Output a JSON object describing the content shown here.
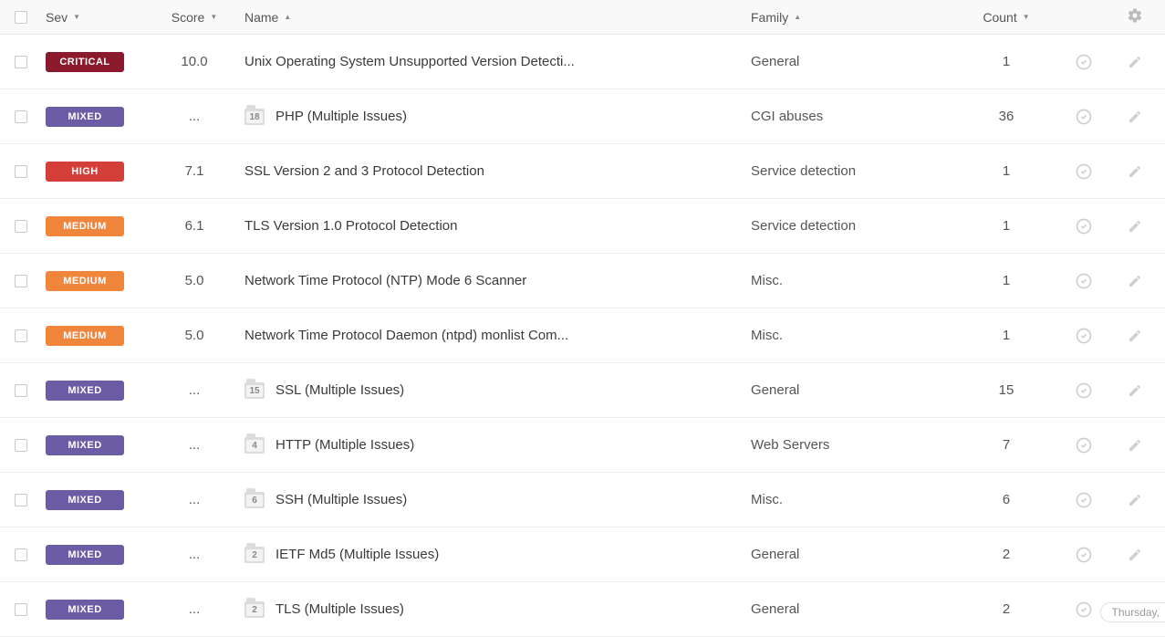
{
  "columns": {
    "sev": {
      "label": "Sev",
      "sort": "desc"
    },
    "score": {
      "label": "Score",
      "sort": "desc"
    },
    "name": {
      "label": "Name",
      "sort": "asc"
    },
    "family": {
      "label": "Family",
      "sort": "asc"
    },
    "count": {
      "label": "Count",
      "sort": "desc"
    }
  },
  "rows": [
    {
      "sev": "CRITICAL",
      "sev_class": "critical",
      "score": "10.0",
      "group_count": null,
      "name": "Unix Operating System Unsupported Version Detecti...",
      "family": "General",
      "count": "1"
    },
    {
      "sev": "MIXED",
      "sev_class": "mixed",
      "score": "...",
      "group_count": "18",
      "name": "PHP (Multiple Issues)",
      "family": "CGI abuses",
      "count": "36"
    },
    {
      "sev": "HIGH",
      "sev_class": "high",
      "score": "7.1",
      "group_count": null,
      "name": "SSL Version 2 and 3 Protocol Detection",
      "family": "Service detection",
      "count": "1"
    },
    {
      "sev": "MEDIUM",
      "sev_class": "medium",
      "score": "6.1",
      "group_count": null,
      "name": "TLS Version 1.0 Protocol Detection",
      "family": "Service detection",
      "count": "1"
    },
    {
      "sev": "MEDIUM",
      "sev_class": "medium",
      "score": "5.0",
      "group_count": null,
      "name": "Network Time Protocol (NTP) Mode 6 Scanner",
      "family": "Misc.",
      "count": "1"
    },
    {
      "sev": "MEDIUM",
      "sev_class": "medium",
      "score": "5.0",
      "group_count": null,
      "name": "Network Time Protocol Daemon (ntpd) monlist Com...",
      "family": "Misc.",
      "count": "1"
    },
    {
      "sev": "MIXED",
      "sev_class": "mixed",
      "score": "...",
      "group_count": "15",
      "name": "SSL (Multiple Issues)",
      "family": "General",
      "count": "15"
    },
    {
      "sev": "MIXED",
      "sev_class": "mixed",
      "score": "...",
      "group_count": "4",
      "name": "HTTP (Multiple Issues)",
      "family": "Web Servers",
      "count": "7"
    },
    {
      "sev": "MIXED",
      "sev_class": "mixed",
      "score": "...",
      "group_count": "6",
      "name": "SSH (Multiple Issues)",
      "family": "Misc.",
      "count": "6"
    },
    {
      "sev": "MIXED",
      "sev_class": "mixed",
      "score": "...",
      "group_count": "2",
      "name": "IETF Md5 (Multiple Issues)",
      "family": "General",
      "count": "2"
    },
    {
      "sev": "MIXED",
      "sev_class": "mixed",
      "score": "...",
      "group_count": "2",
      "name": "TLS (Multiple Issues)",
      "family": "General",
      "count": "2"
    }
  ],
  "footer_timestamp": "Thursday, "
}
